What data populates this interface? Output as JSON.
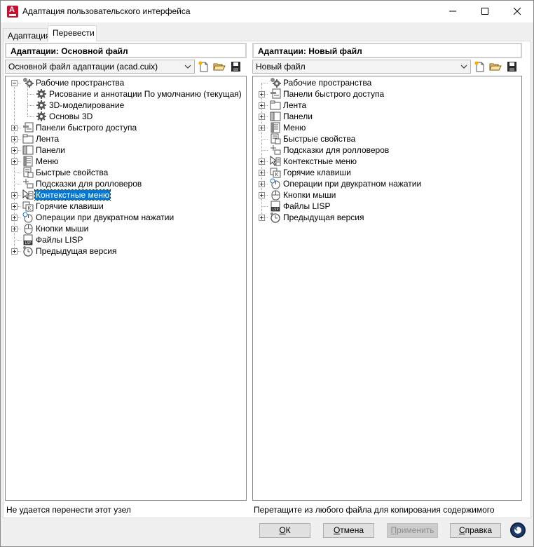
{
  "window": {
    "title": "Адаптация пользовательского интерфейса",
    "app_icon": "autocad-icon"
  },
  "tabs": [
    {
      "label": "Адаптация",
      "active": false
    },
    {
      "label": "Перевести",
      "active": true
    }
  ],
  "left_pane": {
    "header": "Адаптации: Основной файл",
    "select_value": "Основной файл адаптации (acad.cuix)",
    "status": "Не удается перенести этот узел",
    "tree": [
      {
        "label": "Рабочие пространства",
        "icon": "workspaces-icon",
        "level": 0,
        "expander": "minus"
      },
      {
        "label": "Рисование и аннотации По умолчанию (текущая)",
        "icon": "gear-icon",
        "level": 1,
        "expander": ""
      },
      {
        "label": "3D-моделирование",
        "icon": "gear-icon",
        "level": 1,
        "expander": ""
      },
      {
        "label": "Основы 3D",
        "icon": "gear-icon",
        "level": 1,
        "expander": ""
      },
      {
        "label": "Панели быстрого доступа",
        "icon": "toolbar-icon",
        "level": 0,
        "expander": "plus"
      },
      {
        "label": "Лента",
        "icon": "ribbon-icon",
        "level": 0,
        "expander": "plus"
      },
      {
        "label": "Панели",
        "icon": "panels-icon",
        "level": 0,
        "expander": "plus"
      },
      {
        "label": "Меню",
        "icon": "menu-icon",
        "level": 0,
        "expander": "plus"
      },
      {
        "label": "Быстрые свойства",
        "icon": "quick-properties-icon",
        "level": 0,
        "expander": ""
      },
      {
        "label": "Подсказки для ролловеров",
        "icon": "rollover-tooltips-icon",
        "level": 0,
        "expander": ""
      },
      {
        "label": "Контекстные меню",
        "icon": "context-menu-icon",
        "level": 0,
        "expander": "plus",
        "selected": true
      },
      {
        "label": "Горячие клавиши",
        "icon": "keyboard-shortcuts-icon",
        "level": 0,
        "expander": "plus"
      },
      {
        "label": "Операции при двукратном нажатии",
        "icon": "double-click-icon",
        "level": 0,
        "expander": "plus"
      },
      {
        "label": "Кнопки мыши",
        "icon": "mouse-buttons-icon",
        "level": 0,
        "expander": "plus"
      },
      {
        "label": "Файлы LISP",
        "icon": "lisp-files-icon",
        "level": 0,
        "expander": ""
      },
      {
        "label": "Предыдущая версия",
        "icon": "legacy-icon",
        "level": 0,
        "expander": "plus"
      }
    ]
  },
  "right_pane": {
    "header": "Адаптации: Новый файл",
    "select_value": "Новый файл",
    "status": "Перетащите из любого файла для копирования содержимого",
    "tree": [
      {
        "label": "Рабочие пространства",
        "icon": "workspaces-icon",
        "level": 0,
        "expander": ""
      },
      {
        "label": "Панели быстрого доступа",
        "icon": "toolbar-icon",
        "level": 0,
        "expander": "plus"
      },
      {
        "label": "Лента",
        "icon": "ribbon-icon",
        "level": 0,
        "expander": "plus"
      },
      {
        "label": "Панели",
        "icon": "panels-icon",
        "level": 0,
        "expander": "plus"
      },
      {
        "label": "Меню",
        "icon": "menu-icon",
        "level": 0,
        "expander": "plus"
      },
      {
        "label": "Быстрые свойства",
        "icon": "quick-properties-icon",
        "level": 0,
        "expander": ""
      },
      {
        "label": "Подсказки для ролловеров",
        "icon": "rollover-tooltips-icon",
        "level": 0,
        "expander": ""
      },
      {
        "label": "Контекстные меню",
        "icon": "context-menu-icon",
        "level": 0,
        "expander": "plus"
      },
      {
        "label": "Горячие клавиши",
        "icon": "keyboard-shortcuts-icon",
        "level": 0,
        "expander": "plus"
      },
      {
        "label": "Операции при двукратном нажатии",
        "icon": "double-click-icon",
        "level": 0,
        "expander": "plus"
      },
      {
        "label": "Кнопки мыши",
        "icon": "mouse-buttons-icon",
        "level": 0,
        "expander": "plus"
      },
      {
        "label": "Файлы LISP",
        "icon": "lisp-files-icon",
        "level": 0,
        "expander": ""
      },
      {
        "label": "Предыдущая версия",
        "icon": "legacy-icon",
        "level": 0,
        "expander": "plus"
      }
    ]
  },
  "buttons": {
    "ok": {
      "label": "ОК",
      "mnemonic": "О"
    },
    "cancel": {
      "label": "Отмена",
      "mnemonic": "О"
    },
    "apply": {
      "label": "Применить",
      "mnemonic": "П",
      "disabled": true
    },
    "help": {
      "label": "Справка",
      "mnemonic": "С"
    }
  },
  "colors": {
    "selection": "#0078d7",
    "brand": "#c8102e"
  }
}
